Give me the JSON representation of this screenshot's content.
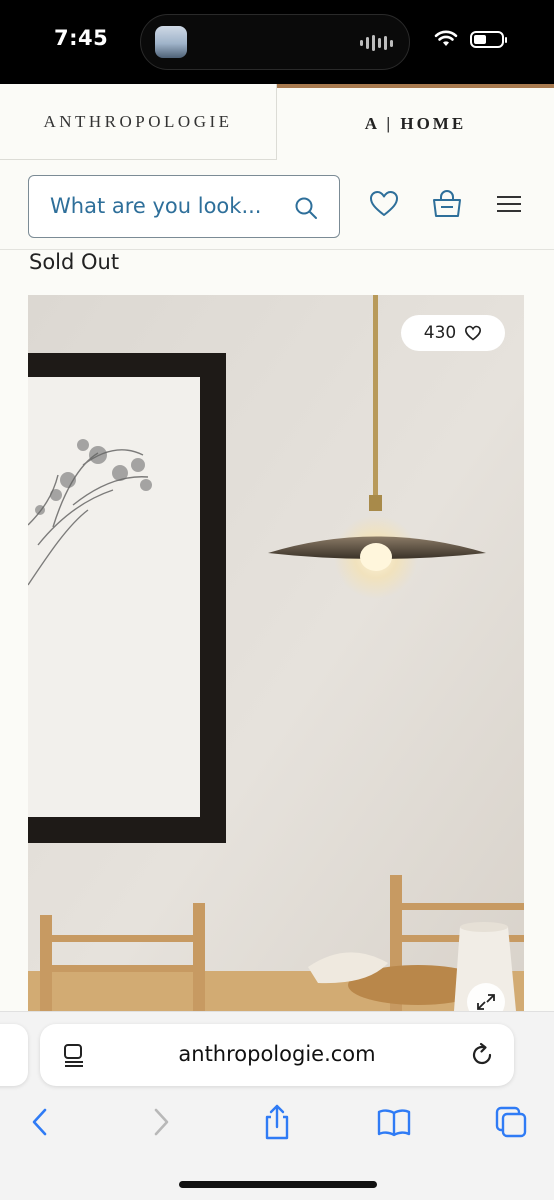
{
  "status_bar": {
    "time": "7:45",
    "icons": [
      "wifi-icon",
      "battery-icon"
    ]
  },
  "brand": {
    "tab_label": "ANTHROPOLOGIE",
    "home_label": "A | HOME",
    "accent": "#a87a4f"
  },
  "search": {
    "placeholder": "What are you look...",
    "accent": "#2e6f9a"
  },
  "header_icons": [
    "heart-icon",
    "bag-icon",
    "menu-icon"
  ],
  "product": {
    "status": "Sold Out",
    "likes": "430"
  },
  "safari": {
    "url": "anthropologie.com"
  },
  "toolbar": {
    "items": [
      "back-icon",
      "forward-icon",
      "share-icon",
      "bookmarks-icon",
      "tabs-icon"
    ]
  },
  "colors": {
    "background": "#fbfbf7",
    "ios_blue": "#2f7bf5"
  }
}
